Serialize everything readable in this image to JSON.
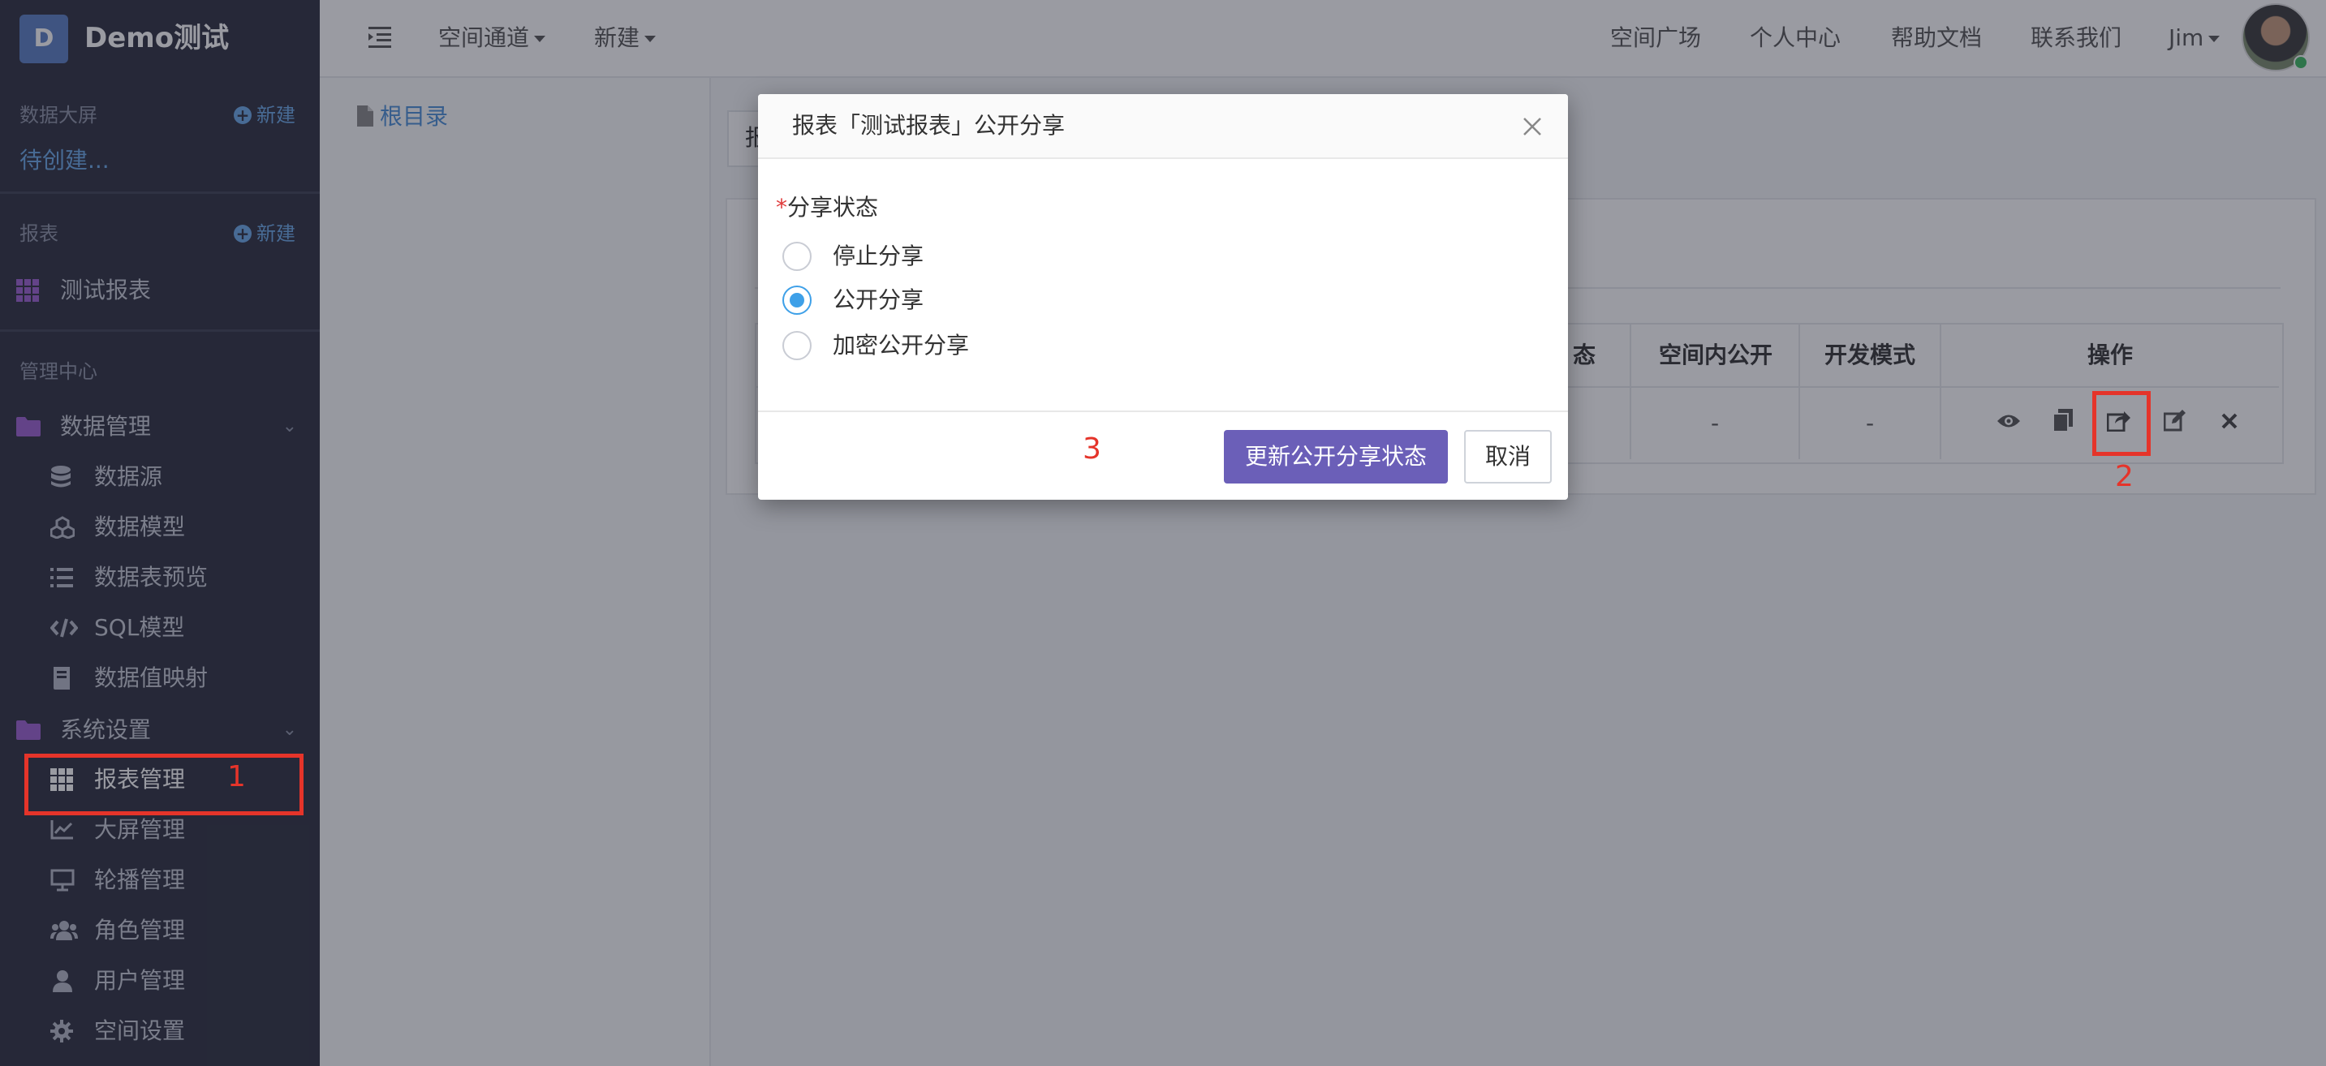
{
  "app": {
    "logo_letter": "D",
    "title": "Demo测试"
  },
  "sidebar": {
    "dashboard": {
      "title": "数据大屏",
      "new_label": "新建",
      "pending": "待创建..."
    },
    "reports": {
      "title": "报表",
      "new_label": "新建",
      "items": [
        {
          "label": "测试报表",
          "icon": "grid-icon"
        }
      ]
    },
    "admin": {
      "title": "管理中心",
      "groups": [
        {
          "label": "数据管理",
          "icon": "folder-icon",
          "items": [
            {
              "label": "数据源",
              "icon": "database-icon"
            },
            {
              "label": "数据模型",
              "icon": "cubes-icon"
            },
            {
              "label": "数据表预览",
              "icon": "list-icon"
            },
            {
              "label": "SQL模型",
              "icon": "code-icon"
            },
            {
              "label": "数据值映射",
              "icon": "book-icon"
            }
          ]
        },
        {
          "label": "系统设置",
          "icon": "folder-icon",
          "items": [
            {
              "label": "报表管理",
              "icon": "grid-icon"
            },
            {
              "label": "大屏管理",
              "icon": "chart-line-icon"
            },
            {
              "label": "轮播管理",
              "icon": "monitor-icon"
            },
            {
              "label": "角色管理",
              "icon": "users-icon"
            },
            {
              "label": "用户管理",
              "icon": "user-icon"
            },
            {
              "label": "空间设置",
              "icon": "gear-icon"
            }
          ]
        }
      ]
    }
  },
  "topbar": {
    "space_channel": "空间通道",
    "new": "新建",
    "links": [
      "空间广场",
      "个人中心",
      "帮助文档",
      "联系我们"
    ],
    "user": "Jim"
  },
  "main": {
    "breadcrumb_root": "根目录",
    "tab_stub": "报",
    "table": {
      "headers": [
        "态",
        "空间内公开",
        "开发模式",
        "操作"
      ],
      "row": [
        "-",
        "-"
      ]
    }
  },
  "modal": {
    "title": "报表「测试报表」公开分享",
    "field_label": "分享状态",
    "required_mark": "*",
    "options": [
      "停止分享",
      "公开分享",
      "加密公开分享"
    ],
    "selected": "公开分享",
    "primary_button": "更新公开分享状态",
    "cancel_button": "取消"
  },
  "annotations": {
    "n1": "1",
    "n2": "2",
    "n3": "3",
    "color": "#e5342a"
  },
  "colors": {
    "sidebar_bg": "#2c2f3e",
    "primary": "#6b5fb8",
    "link": "#4a8fd8",
    "radio": "#3ea0e8"
  }
}
